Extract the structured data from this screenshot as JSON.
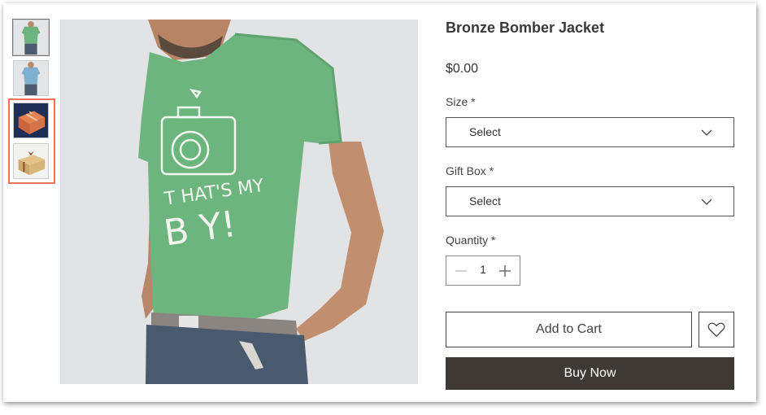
{
  "product": {
    "title": "Bronze Bomber Jacket",
    "price": "$0.00"
  },
  "thumbnails": [
    {
      "name": "green-tshirt-front",
      "selected": true
    },
    {
      "name": "blue-tshirt"
    },
    {
      "name": "orange-gift-box"
    },
    {
      "name": "gold-gift-box"
    }
  ],
  "options": {
    "size": {
      "label": "Size *",
      "value": "Select"
    },
    "gift_box": {
      "label": "Gift Box *",
      "value": "Select"
    }
  },
  "quantity": {
    "label": "Quantity *",
    "value": "1"
  },
  "buttons": {
    "add_to_cart": "Add to Cart",
    "buy_now": "Buy Now"
  },
  "main_image": {
    "tshirt_print": "THAT'S MY BABY!"
  },
  "colors": {
    "accent_highlight": "#e8755a",
    "buy_now_bg": "#3f3934",
    "shirt_green": "#6db57e"
  }
}
